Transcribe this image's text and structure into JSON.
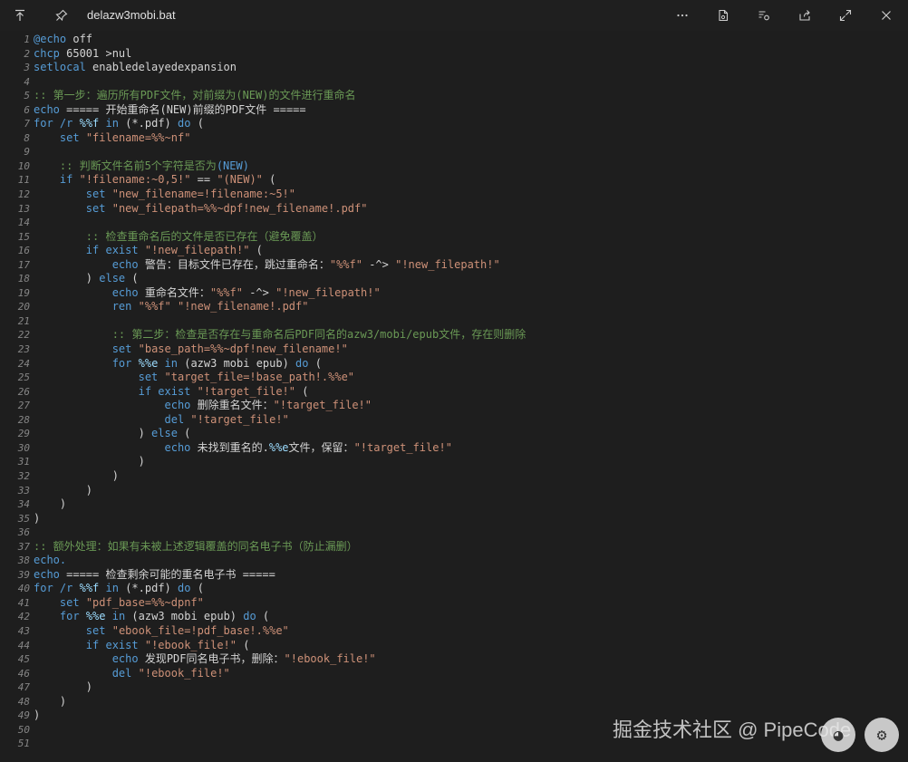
{
  "window": {
    "title": "delazw3mobi.bat",
    "icons": {
      "up": "arrow-up-to-line-icon",
      "pin": "pin-icon",
      "more": "more-horizontal-icon",
      "save": "save-file-icon",
      "settings": "file-settings-icon",
      "share": "share-icon",
      "expand": "expand-icon",
      "close": "close-icon"
    }
  },
  "watermark": "掘金技术社区 @ PipeCode",
  "code_lines": [
    [
      [
        "kw",
        "@echo"
      ],
      [
        "plain",
        " off"
      ]
    ],
    [
      [
        "kw",
        "chcp"
      ],
      [
        "plain",
        " 65001 >nul"
      ]
    ],
    [
      [
        "kw",
        "setlocal"
      ],
      [
        "plain",
        " enabledelayedexpansion"
      ]
    ],
    [],
    [
      [
        "cmt",
        ":: 第一步：遍历所有PDF文件，对前缀为(NEW)的文件进行重命名"
      ]
    ],
    [
      [
        "kw",
        "echo"
      ],
      [
        "plain",
        " ===== 开始重命名(NEW)前缀的PDF文件 ====="
      ]
    ],
    [
      [
        "kw",
        "for"
      ],
      [
        "plain",
        " "
      ],
      [
        "kw",
        "/r"
      ],
      [
        "plain",
        " "
      ],
      [
        "var",
        "%%f"
      ],
      [
        "plain",
        " "
      ],
      [
        "kw",
        "in"
      ],
      [
        "plain",
        " (*.pdf) "
      ],
      [
        "kw",
        "do"
      ],
      [
        "plain",
        " ("
      ]
    ],
    [
      [
        "plain",
        "    "
      ],
      [
        "kw",
        "set"
      ],
      [
        "plain",
        " "
      ],
      [
        "str",
        "\"filename=%%~nf\""
      ]
    ],
    [],
    [
      [
        "plain",
        "    "
      ],
      [
        "cmt",
        ":: 判断文件名前5个字符是否为"
      ],
      [
        "kw",
        "(NEW)"
      ]
    ],
    [
      [
        "plain",
        "    "
      ],
      [
        "kw",
        "if"
      ],
      [
        "plain",
        " "
      ],
      [
        "str",
        "\"!filename:~0,5!\""
      ],
      [
        "plain",
        " == "
      ],
      [
        "str",
        "\"(NEW)\""
      ],
      [
        "plain",
        " ("
      ]
    ],
    [
      [
        "plain",
        "        "
      ],
      [
        "kw",
        "set"
      ],
      [
        "plain",
        " "
      ],
      [
        "str",
        "\"new_filename=!filename:~5!\""
      ]
    ],
    [
      [
        "plain",
        "        "
      ],
      [
        "kw",
        "set"
      ],
      [
        "plain",
        " "
      ],
      [
        "str",
        "\"new_filepath=%%~dpf!new_filename!.pdf\""
      ]
    ],
    [],
    [
      [
        "plain",
        "        "
      ],
      [
        "cmt",
        ":: 检查重命名后的文件是否已存在（避免覆盖）"
      ]
    ],
    [
      [
        "plain",
        "        "
      ],
      [
        "kw",
        "if"
      ],
      [
        "plain",
        " "
      ],
      [
        "kw",
        "exist"
      ],
      [
        "plain",
        " "
      ],
      [
        "str",
        "\"!new_filepath!\""
      ],
      [
        "plain",
        " ("
      ]
    ],
    [
      [
        "plain",
        "            "
      ],
      [
        "kw",
        "echo"
      ],
      [
        "plain",
        " 警告：目标文件已存在，跳过重命名："
      ],
      [
        "str",
        "\"%%f\""
      ],
      [
        "plain",
        " -^> "
      ],
      [
        "str",
        "\"!new_filepath!\""
      ]
    ],
    [
      [
        "plain",
        "        ) "
      ],
      [
        "kw",
        "else"
      ],
      [
        "plain",
        " ("
      ]
    ],
    [
      [
        "plain",
        "            "
      ],
      [
        "kw",
        "echo"
      ],
      [
        "plain",
        " 重命名文件："
      ],
      [
        "str",
        "\"%%f\""
      ],
      [
        "plain",
        " -^> "
      ],
      [
        "str",
        "\"!new_filepath!\""
      ]
    ],
    [
      [
        "plain",
        "            "
      ],
      [
        "kw",
        "ren"
      ],
      [
        "plain",
        " "
      ],
      [
        "str",
        "\"%%f\""
      ],
      [
        "plain",
        " "
      ],
      [
        "str",
        "\"!new_filename!.pdf\""
      ]
    ],
    [],
    [
      [
        "plain",
        "            "
      ],
      [
        "cmt",
        ":: 第二步：检查是否存在与重命名后PDF同名的azw3/mobi/epub文件，存在则删除"
      ]
    ],
    [
      [
        "plain",
        "            "
      ],
      [
        "kw",
        "set"
      ],
      [
        "plain",
        " "
      ],
      [
        "str",
        "\"base_path=%%~dpf!new_filename!\""
      ]
    ],
    [
      [
        "plain",
        "            "
      ],
      [
        "kw",
        "for"
      ],
      [
        "plain",
        " "
      ],
      [
        "var",
        "%%e"
      ],
      [
        "plain",
        " "
      ],
      [
        "kw",
        "in"
      ],
      [
        "plain",
        " (azw3 mobi epub) "
      ],
      [
        "kw",
        "do"
      ],
      [
        "plain",
        " ("
      ]
    ],
    [
      [
        "plain",
        "                "
      ],
      [
        "kw",
        "set"
      ],
      [
        "plain",
        " "
      ],
      [
        "str",
        "\"target_file=!base_path!.%%e\""
      ]
    ],
    [
      [
        "plain",
        "                "
      ],
      [
        "kw",
        "if"
      ],
      [
        "plain",
        " "
      ],
      [
        "kw",
        "exist"
      ],
      [
        "plain",
        " "
      ],
      [
        "str",
        "\"!target_file!\""
      ],
      [
        "plain",
        " ("
      ]
    ],
    [
      [
        "plain",
        "                    "
      ],
      [
        "kw",
        "echo"
      ],
      [
        "plain",
        " 删除重名文件："
      ],
      [
        "str",
        "\"!target_file!\""
      ]
    ],
    [
      [
        "plain",
        "                    "
      ],
      [
        "kw",
        "del"
      ],
      [
        "plain",
        " "
      ],
      [
        "str",
        "\"!target_file!\""
      ]
    ],
    [
      [
        "plain",
        "                ) "
      ],
      [
        "kw",
        "else"
      ],
      [
        "plain",
        " ("
      ]
    ],
    [
      [
        "plain",
        "                    "
      ],
      [
        "kw",
        "echo"
      ],
      [
        "plain",
        " 未找到重名的."
      ],
      [
        "var",
        "%%e"
      ],
      [
        "plain",
        "文件，保留："
      ],
      [
        "str",
        "\"!target_file!\""
      ]
    ],
    [
      [
        "plain",
        "                )"
      ]
    ],
    [
      [
        "plain",
        "            )"
      ]
    ],
    [
      [
        "plain",
        "        )"
      ]
    ],
    [
      [
        "plain",
        "    )"
      ]
    ],
    [
      [
        "plain",
        ")"
      ]
    ],
    [],
    [
      [
        "cmt",
        ":: 额外处理：如果有未被上述逻辑覆盖的同名电子书（防止漏删）"
      ]
    ],
    [
      [
        "kw",
        "echo."
      ]
    ],
    [
      [
        "kw",
        "echo"
      ],
      [
        "plain",
        " ===== 检查剩余可能的重名电子书 ====="
      ]
    ],
    [
      [
        "kw",
        "for"
      ],
      [
        "plain",
        " "
      ],
      [
        "kw",
        "/r"
      ],
      [
        "plain",
        " "
      ],
      [
        "var",
        "%%f"
      ],
      [
        "plain",
        " "
      ],
      [
        "kw",
        "in"
      ],
      [
        "plain",
        " (*.pdf) "
      ],
      [
        "kw",
        "do"
      ],
      [
        "plain",
        " ("
      ]
    ],
    [
      [
        "plain",
        "    "
      ],
      [
        "kw",
        "set"
      ],
      [
        "plain",
        " "
      ],
      [
        "str",
        "\"pdf_base=%%~dpnf\""
      ]
    ],
    [
      [
        "plain",
        "    "
      ],
      [
        "kw",
        "for"
      ],
      [
        "plain",
        " "
      ],
      [
        "var",
        "%%e"
      ],
      [
        "plain",
        " "
      ],
      [
        "kw",
        "in"
      ],
      [
        "plain",
        " (azw3 mobi epub) "
      ],
      [
        "kw",
        "do"
      ],
      [
        "plain",
        " ("
      ]
    ],
    [
      [
        "plain",
        "        "
      ],
      [
        "kw",
        "set"
      ],
      [
        "plain",
        " "
      ],
      [
        "str",
        "\"ebook_file=!pdf_base!.%%e\""
      ]
    ],
    [
      [
        "plain",
        "        "
      ],
      [
        "kw",
        "if"
      ],
      [
        "plain",
        " "
      ],
      [
        "kw",
        "exist"
      ],
      [
        "plain",
        " "
      ],
      [
        "str",
        "\"!ebook_file!\""
      ],
      [
        "plain",
        " ("
      ]
    ],
    [
      [
        "plain",
        "            "
      ],
      [
        "kw",
        "echo"
      ],
      [
        "plain",
        " 发现PDF同名电子书，删除："
      ],
      [
        "str",
        "\"!ebook_file!\""
      ]
    ],
    [
      [
        "plain",
        "            "
      ],
      [
        "kw",
        "del"
      ],
      [
        "plain",
        " "
      ],
      [
        "str",
        "\"!ebook_file!\""
      ]
    ],
    [
      [
        "plain",
        "        )"
      ]
    ],
    [
      [
        "plain",
        "    )"
      ]
    ],
    [
      [
        "plain",
        ")"
      ]
    ],
    [],
    []
  ]
}
